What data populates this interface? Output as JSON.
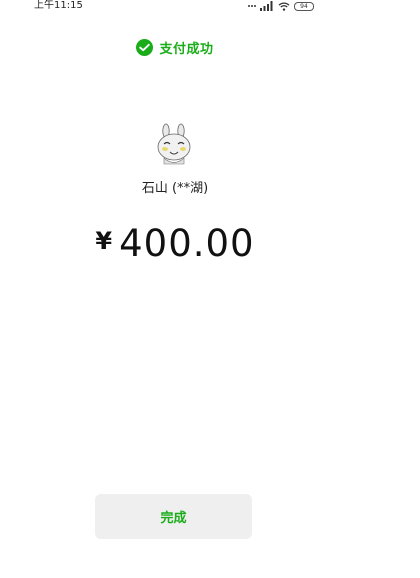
{
  "status_bar": {
    "time": "上午11:15",
    "battery": "94"
  },
  "header": {
    "title": "支付成功",
    "accent_color": "#1aad19"
  },
  "merchant": {
    "name": "石山 (**湖)"
  },
  "payment": {
    "currency_symbol": "¥",
    "amount": "400.00"
  },
  "actions": {
    "done_label": "完成"
  }
}
